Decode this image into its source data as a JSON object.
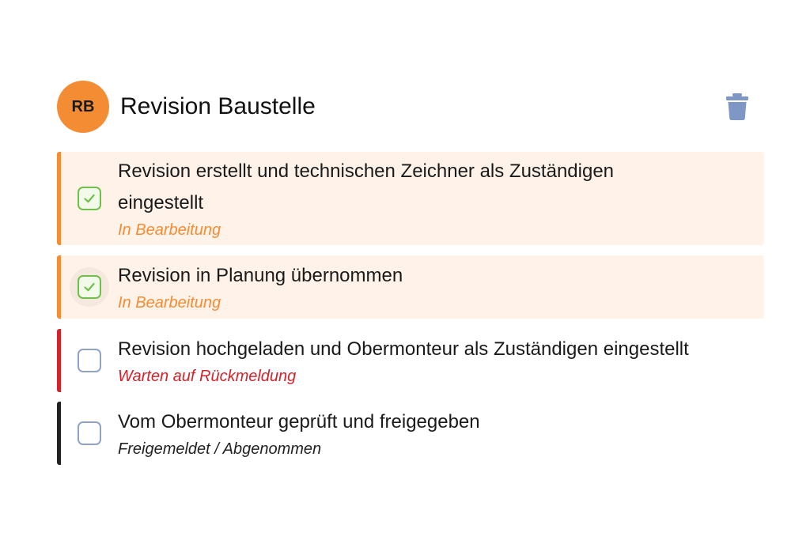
{
  "header": {
    "avatar_initials": "RB",
    "avatar_color": "#f48c34",
    "title": "Revision Baustelle",
    "delete_icon": "trash-icon",
    "delete_icon_color": "#7f97c4"
  },
  "tasks": [
    {
      "text": "Revision erstellt und technischen Zeichner als Zuständigen eingestellt",
      "status": "In Bearbeitung",
      "checked": true,
      "accent_color": "#f48c34",
      "status_color": "#f48c34",
      "background": "#fff2e8"
    },
    {
      "text": "Revision in Planung übernommen",
      "status": "In Bearbeitung",
      "checked": true,
      "accent_color": "#f48c34",
      "status_color": "#f48c34",
      "background": "#fff2e8"
    },
    {
      "text": "Revision hochgeladen und Obermonteur als Zuständigen eingestellt",
      "status": "Warten auf Rückmeldung",
      "checked": false,
      "accent_color": "#d2232a",
      "status_color": "#d2232a",
      "background": "#ffffff"
    },
    {
      "text": "Vom Obermonteur geprüft und freigegeben",
      "status": "Freigemeldet / Abgenommen",
      "checked": false,
      "accent_color": "#222222",
      "status_color": "#222222",
      "background": "#ffffff"
    }
  ]
}
